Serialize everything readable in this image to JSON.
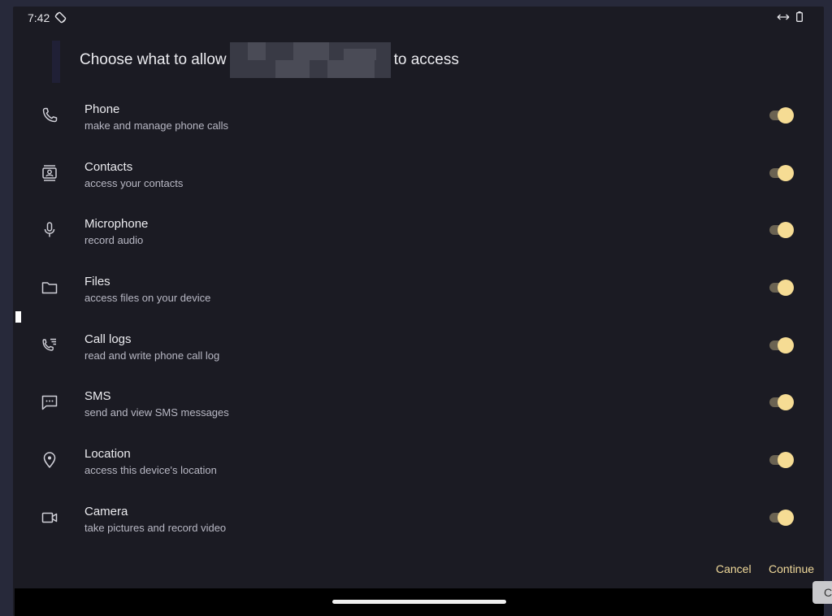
{
  "status_bar": {
    "time": "7:42",
    "icons": [
      "auto-rotate-icon",
      "expand-horizontal-icon",
      "battery-icon"
    ]
  },
  "dialog": {
    "title_prefix": "Choose what to allow",
    "title_suffix": "to access",
    "permissions": [
      {
        "name": "phone",
        "title": "Phone",
        "subtitle": "make and manage phone calls",
        "icon": "phone-icon",
        "enabled": true
      },
      {
        "name": "contacts",
        "title": "Contacts",
        "subtitle": "access your contacts",
        "icon": "contacts-icon",
        "enabled": true
      },
      {
        "name": "microphone",
        "title": "Microphone",
        "subtitle": "record audio",
        "icon": "microphone-icon",
        "enabled": true
      },
      {
        "name": "files",
        "title": "Files",
        "subtitle": "access files on your device",
        "icon": "folder-icon",
        "enabled": true
      },
      {
        "name": "call-logs",
        "title": "Call logs",
        "subtitle": "read and write phone call log",
        "icon": "call-log-icon",
        "enabled": true
      },
      {
        "name": "sms",
        "title": "SMS",
        "subtitle": "send and view SMS messages",
        "icon": "message-icon",
        "enabled": true
      },
      {
        "name": "location",
        "title": "Location",
        "subtitle": "access this device's location",
        "icon": "location-pin-icon",
        "enabled": true
      },
      {
        "name": "camera",
        "title": "Camera",
        "subtitle": "take pictures and record video",
        "icon": "video-camera-icon",
        "enabled": true
      }
    ],
    "cancel_label": "Cancel",
    "continue_label": "Continue"
  },
  "corner_button_label": "C",
  "colors": {
    "background": "#1b1b23",
    "accent": "#f6dc94",
    "toggle_track": "#6b6352",
    "text_primary": "#ececf0",
    "text_secondary": "#b8b8c4"
  }
}
